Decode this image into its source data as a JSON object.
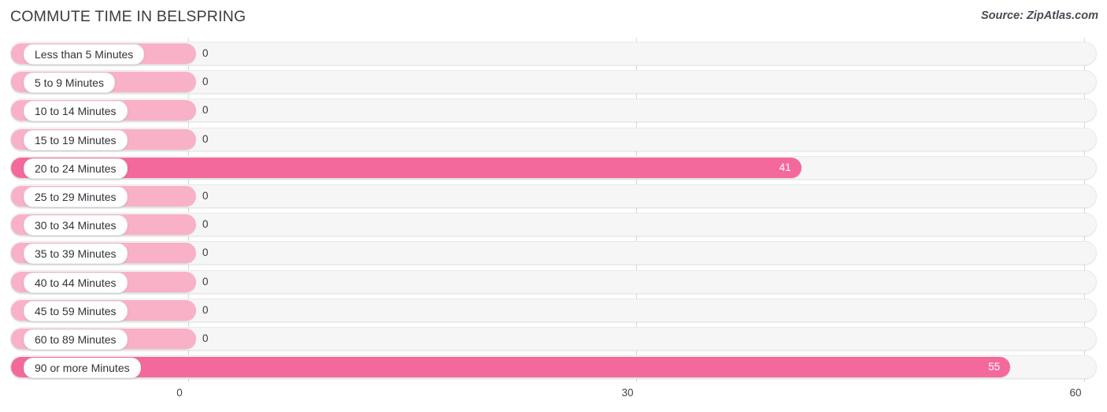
{
  "header": {
    "title": "COMMUTE TIME IN BELSPRING",
    "source": "Source: ZipAtlas.com"
  },
  "colors": {
    "bar_low": "#f9b1c8",
    "bar_high": "#f4699b",
    "track": "#f6f6f6",
    "gridline": "#d8d8d8",
    "value_text_dark": "#3a3a3a",
    "value_text_light": "#ffffff"
  },
  "chart_data": {
    "type": "bar",
    "orientation": "horizontal",
    "title": "COMMUTE TIME IN BELSPRING",
    "xlabel": "",
    "ylabel": "",
    "xlim": [
      0,
      60
    ],
    "ticks": [
      0,
      30,
      60
    ],
    "tick_labels": [
      "0",
      "30",
      "60"
    ],
    "grid": true,
    "legend": false,
    "categories": [
      "Less than 5 Minutes",
      "5 to 9 Minutes",
      "10 to 14 Minutes",
      "15 to 19 Minutes",
      "20 to 24 Minutes",
      "25 to 29 Minutes",
      "30 to 34 Minutes",
      "35 to 39 Minutes",
      "40 to 44 Minutes",
      "45 to 59 Minutes",
      "60 to 89 Minutes",
      "90 or more Minutes"
    ],
    "values": [
      0,
      0,
      0,
      0,
      41,
      0,
      0,
      0,
      0,
      0,
      0,
      55
    ],
    "value_labels": [
      "0",
      "0",
      "0",
      "0",
      "41",
      "0",
      "0",
      "0",
      "0",
      "0",
      "0",
      "55"
    ]
  }
}
